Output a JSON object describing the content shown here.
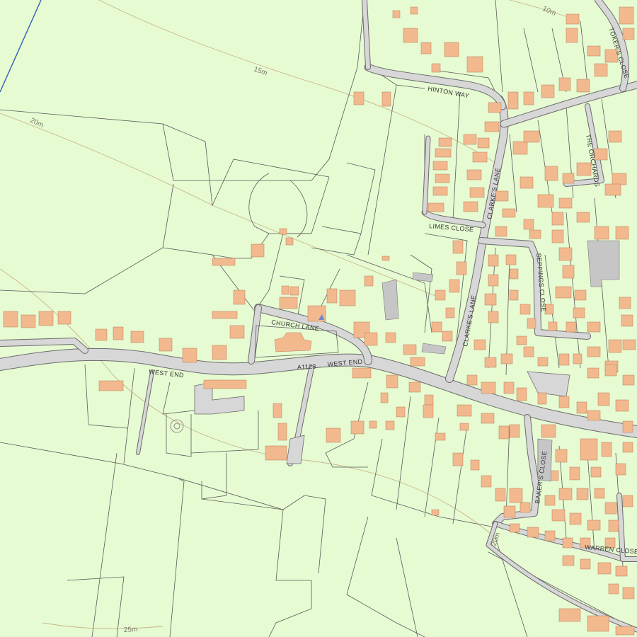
{
  "map": {
    "background_color": "#e6fbd2",
    "building_color": "#f2b98f",
    "road_color": "#d7d7d7",
    "parcel_line_color": "#5a5a5a",
    "contour_color": "#c9b58a",
    "water_color": "#2d5fb8"
  },
  "road_labels": {
    "west_end_1": "WEST END",
    "west_end_2": "WEST END",
    "a1123": "A1123",
    "church_lane": "CHURCH LANE",
    "hinton_way": "HINTON WAY",
    "limes_close": "LIMES CLOSE",
    "clarkes_lane_1": "CLARKE'S LANE",
    "clarkes_lane_2": "CLARKE'S LANE",
    "seppings_close": "SEPPINGS CLOSE",
    "the_orchards": "THE ORCHARDS",
    "tokers_close": "TOKER'S CLOSE",
    "bakers_close": "BAKER'S CLOSE",
    "warren_close": "WARREN CLOSE"
  },
  "contour_labels": {
    "c10": "10m",
    "c15": "15m",
    "c20": "20m",
    "c20b": "20m",
    "c25": "25m"
  }
}
